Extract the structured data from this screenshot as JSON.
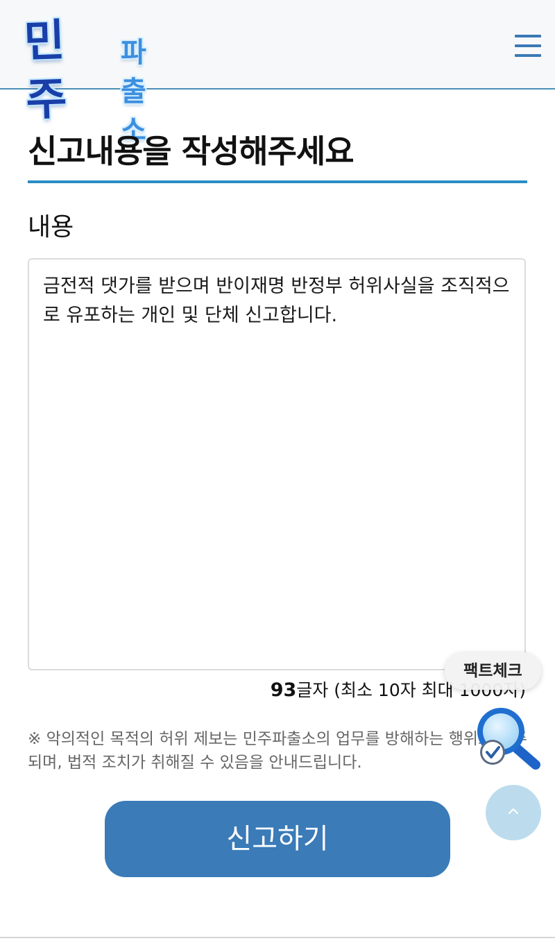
{
  "header": {
    "logo_main": "민주",
    "logo_sub": "파출소",
    "menu_icon": "hamburger-menu-icon"
  },
  "form": {
    "title": "신고내용을 작성해주세요",
    "content_label": "내용",
    "content_value": "금전적 댓가를 받으며 반이재명 반정부 허위사실을 조직적으로 유포하는 개인 및 단체 신고합니다.",
    "char_count": "93",
    "char_count_suffix": "글자 (최소 10자 최대 1000자)",
    "notice": "※ 악의적인 목적의 허위 제보는 민주파출소의 업무를 방해하는 행위로 간주되며, 법적 조치가 취해질 수 있음을 안내드립니다.",
    "submit_label": "신고하기"
  },
  "floating": {
    "factcheck_label": "팩트체크",
    "factcheck_icon": "magnifier-check-icon",
    "top_icon": "chevron-up-icon"
  },
  "colors": {
    "accent": "#2a8dc5",
    "button": "#3a7bb8",
    "logo_dark": "#1a3ea8",
    "logo_light": "#3d8fe0"
  }
}
